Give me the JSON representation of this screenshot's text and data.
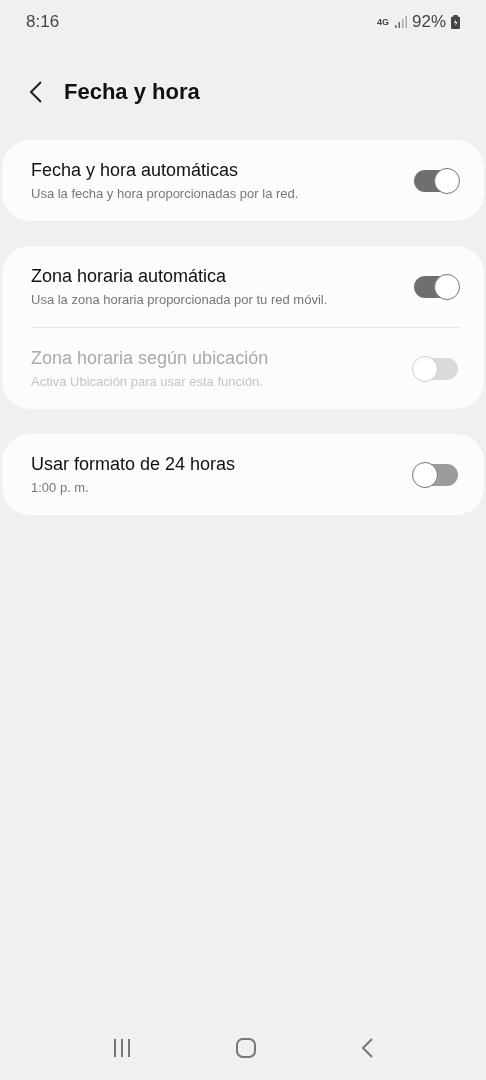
{
  "status_bar": {
    "time": "8:16",
    "network": "4G",
    "battery": "92%"
  },
  "header": {
    "title": "Fecha y hora"
  },
  "groups": [
    {
      "rows": [
        {
          "title": "Fecha y hora automáticas",
          "subtitle": "Usa la fecha y hora proporcionadas por la red.",
          "on": true,
          "disabled": false
        }
      ]
    },
    {
      "rows": [
        {
          "title": "Zona horaria automática",
          "subtitle": "Usa la zona horaria proporcionada por tu red móvil.",
          "on": true,
          "disabled": false
        },
        {
          "title": "Zona horaria según ubicación",
          "subtitle": "Activa Ubicación para usar esta función.",
          "on": false,
          "disabled": true
        }
      ]
    },
    {
      "rows": [
        {
          "title": "Usar formato de 24 horas",
          "subtitle": "1:00 p. m.",
          "on": false,
          "disabled": false
        }
      ]
    }
  ]
}
